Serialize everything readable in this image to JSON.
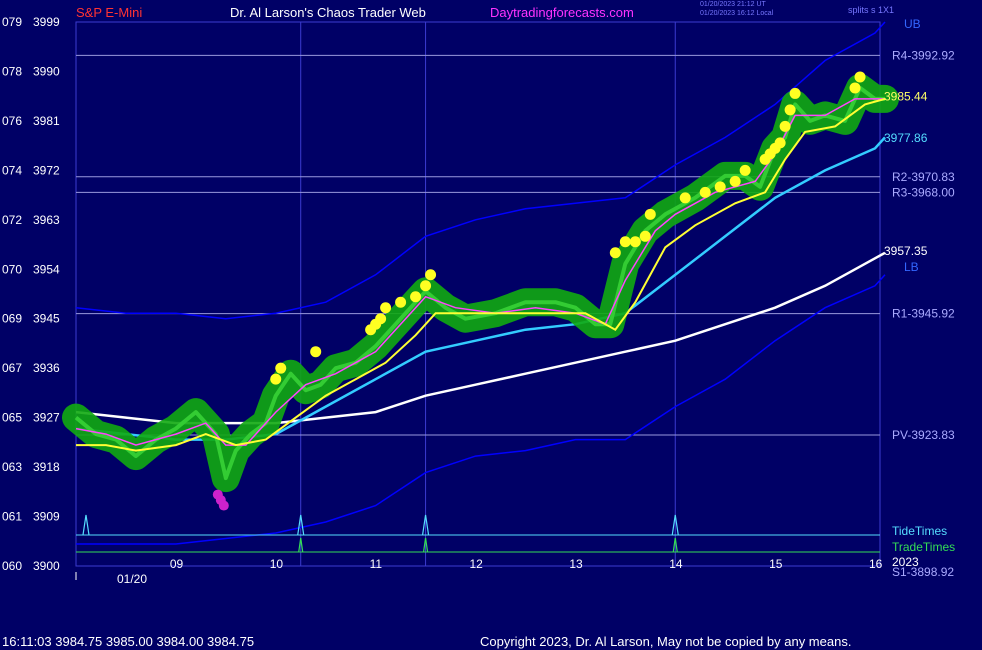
{
  "header": {
    "symbol": "S&P E-Mini",
    "title": "Dr. Al Larson's Chaos Trader Web",
    "site": "Daytradingforecasts.com",
    "timestamp_ut": "01/20/2023 21:12 UT",
    "timestamp_local": "01/20/2023 16:12 Local",
    "splits": "splits s 1X1"
  },
  "footer": {
    "last_bar": "16:11:03  3984.75 3985.00 3984.00 3984.75",
    "copyright": "Copyright 2023, Dr. Al Larson, May not be copied by any means."
  },
  "colors": {
    "background": "#000066",
    "grid": "#3b3bd0",
    "price": "#33cc33",
    "glow": "#11aa11",
    "ema_fast": "#ff44ff",
    "ema_slow": "#ffff33",
    "band": "#0000ff",
    "mid_line": "#33ccff",
    "pivot_line": "#ffffff",
    "markers_up": "#ffff22",
    "markers_down": "#cc22cc",
    "tide": "#55ddff",
    "trade": "#33dd55",
    "level_label": "#aaaaff"
  },
  "chart_data": {
    "type": "line",
    "title": "S&P E-Mini",
    "date": "01/20",
    "year": "2023",
    "ylim": [
      3900,
      3999
    ],
    "xlim": [
      8.0,
      16.05
    ],
    "y_ticks": [
      {
        "left": "079",
        "value": 3999
      },
      {
        "left": "078",
        "value": 3990
      },
      {
        "left": "076",
        "value": 3981
      },
      {
        "left": "074",
        "value": 3972
      },
      {
        "left": "072",
        "value": 3963
      },
      {
        "left": "070",
        "value": 3954
      },
      {
        "left": "069",
        "value": 3945
      },
      {
        "left": "067",
        "value": 3936
      },
      {
        "left": "065",
        "value": 3927
      },
      {
        "left": "063",
        "value": 3918
      },
      {
        "left": "061",
        "value": 3909
      },
      {
        "left": "060",
        "value": 3900
      }
    ],
    "x_ticks": [
      {
        "label": "09",
        "hour": 9
      },
      {
        "label": "10",
        "hour": 10
      },
      {
        "label": "11",
        "hour": 11
      },
      {
        "label": "12",
        "hour": 12
      },
      {
        "label": "13",
        "hour": 13
      },
      {
        "label": "14",
        "hour": 14
      },
      {
        "label": "15",
        "hour": 15
      },
      {
        "label": "16",
        "hour": 16
      }
    ],
    "levels": [
      {
        "label": "R4-3992.92",
        "value": 3992.92
      },
      {
        "label": "R2-3970.83",
        "value": 3970.83
      },
      {
        "label": "R3-3968.00",
        "value": 3968.0
      },
      {
        "label": "R1-3945.92",
        "value": 3945.92
      },
      {
        "label": "PV-3923.83",
        "value": 3923.83
      },
      {
        "label": "S1-3898.92",
        "value": 3898.92
      }
    ],
    "grid_vertical_hours": [
      10.25,
      11.5,
      14.0
    ],
    "band_labels": {
      "upper": "UB",
      "lower": "LB"
    },
    "value_labels": [
      {
        "text": "3985.44",
        "value": 3985.44,
        "color": "#ffff66"
      },
      {
        "text": "3977.86",
        "value": 3977.86,
        "color": "#55ddff"
      },
      {
        "text": "3957.35",
        "value": 3957.35,
        "color": "#ffffff"
      }
    ],
    "tide_times": {
      "label": "TideTimes",
      "hours": [
        8.1,
        10.25,
        11.5,
        14.0
      ]
    },
    "trade_times": {
      "label": "TradeTimes",
      "hours": [
        10.25,
        11.5,
        14.0
      ]
    },
    "series": [
      {
        "name": "price",
        "x": [
          8.0,
          8.2,
          8.4,
          8.6,
          8.8,
          9.0,
          9.2,
          9.4,
          9.5,
          9.6,
          9.75,
          9.9,
          10.0,
          10.15,
          10.3,
          10.45,
          10.6,
          10.8,
          11.0,
          11.2,
          11.4,
          11.5,
          11.7,
          11.9,
          12.2,
          12.5,
          12.8,
          13.0,
          13.2,
          13.35,
          13.5,
          13.7,
          13.9,
          14.0,
          14.2,
          14.5,
          14.7,
          14.85,
          15.0,
          15.1,
          15.2,
          15.35,
          15.5,
          15.7,
          15.85,
          16.0,
          16.1
        ],
        "y": [
          3927,
          3924,
          3923,
          3920,
          3923,
          3925,
          3928,
          3924,
          3916,
          3921,
          3924,
          3926,
          3931,
          3935,
          3932,
          3933,
          3936,
          3937,
          3940,
          3944,
          3948,
          3950,
          3947,
          3945,
          3946,
          3948,
          3948,
          3947,
          3944,
          3944,
          3955,
          3961,
          3964,
          3965,
          3967,
          3971,
          3971,
          3969,
          3976,
          3978,
          3984,
          3981,
          3982,
          3981,
          3987,
          3985,
          3985
        ]
      },
      {
        "name": "ema_fast",
        "x": [
          8.0,
          8.3,
          8.6,
          9.0,
          9.3,
          9.5,
          9.7,
          10.0,
          10.3,
          10.6,
          11.0,
          11.3,
          11.5,
          11.8,
          12.2,
          12.6,
          13.0,
          13.3,
          13.5,
          13.8,
          14.0,
          14.4,
          14.8,
          15.0,
          15.2,
          15.5,
          15.8,
          16.0,
          16.1
        ],
        "y": [
          3925,
          3924,
          3922,
          3924,
          3926,
          3922,
          3922,
          3928,
          3933,
          3935,
          3939,
          3945,
          3949,
          3947,
          3946,
          3947,
          3946,
          3944,
          3952,
          3961,
          3964,
          3968,
          3970,
          3975,
          3982,
          3982,
          3985,
          3985,
          3985
        ]
      },
      {
        "name": "ema_slow",
        "x": [
          8.0,
          8.3,
          8.6,
          9.0,
          9.3,
          9.6,
          9.9,
          10.2,
          10.5,
          10.8,
          11.1,
          11.4,
          11.6,
          12.0,
          12.4,
          12.8,
          13.1,
          13.4,
          13.6,
          13.9,
          14.2,
          14.6,
          14.9,
          15.1,
          15.3,
          15.6,
          15.9,
          16.1
        ],
        "y": [
          3922,
          3922,
          3921,
          3922,
          3924,
          3922,
          3923,
          3927,
          3931,
          3934,
          3937,
          3942,
          3946,
          3946,
          3946,
          3946,
          3946,
          3943,
          3948,
          3958,
          3962,
          3966,
          3968,
          3974,
          3979,
          3980,
          3984,
          3985
        ]
      },
      {
        "name": "upper_band",
        "x": [
          8.0,
          8.5,
          9.0,
          9.5,
          10.0,
          10.5,
          11.0,
          11.5,
          12.0,
          12.5,
          13.0,
          13.5,
          14.0,
          14.5,
          15.0,
          15.5,
          16.0,
          16.1
        ],
        "y": [
          3947,
          3946,
          3946,
          3945,
          3946,
          3948,
          3953,
          3960,
          3963,
          3965,
          3966,
          3967,
          3973,
          3978,
          3984,
          3992,
          3997,
          3999
        ]
      },
      {
        "name": "lower_band",
        "x": [
          8.0,
          8.5,
          9.0,
          9.5,
          10.0,
          10.5,
          11.0,
          11.5,
          12.0,
          12.5,
          13.0,
          13.5,
          14.0,
          14.5,
          15.0,
          15.5,
          16.0,
          16.1
        ],
        "y": [
          3904,
          3904,
          3904,
          3905,
          3906,
          3908,
          3911,
          3917,
          3920,
          3921,
          3923,
          3923,
          3929,
          3934,
          3941,
          3947,
          3951,
          3953
        ]
      },
      {
        "name": "mid_line",
        "x": [
          8.0,
          8.5,
          9.0,
          9.5,
          10.0,
          10.5,
          11.0,
          11.5,
          12.0,
          12.5,
          13.0,
          13.5,
          14.0,
          14.5,
          15.0,
          15.5,
          16.0,
          16.1
        ],
        "y": [
          3925,
          3924,
          3923,
          3923,
          3924,
          3929,
          3934,
          3939,
          3941,
          3943,
          3944,
          3946,
          3953,
          3960,
          3967,
          3972,
          3976,
          3978
        ]
      },
      {
        "name": "pivot_avg",
        "x": [
          8.0,
          8.5,
          9.0,
          9.5,
          10.0,
          10.5,
          11.0,
          11.5,
          12.0,
          12.5,
          13.0,
          13.5,
          14.0,
          14.5,
          15.0,
          15.5,
          16.0,
          16.1
        ],
        "y": [
          3928,
          3927,
          3926,
          3926,
          3926,
          3927,
          3928,
          3931,
          3933,
          3935,
          3937,
          3939,
          3941,
          3944,
          3947,
          3951,
          3956,
          3957
        ]
      }
    ],
    "markers_up": [
      {
        "x": 10.0,
        "y": 3934
      },
      {
        "x": 10.05,
        "y": 3936
      },
      {
        "x": 10.4,
        "y": 3939
      },
      {
        "x": 10.95,
        "y": 3943
      },
      {
        "x": 11.0,
        "y": 3944
      },
      {
        "x": 11.05,
        "y": 3945
      },
      {
        "x": 11.1,
        "y": 3947
      },
      {
        "x": 11.25,
        "y": 3948
      },
      {
        "x": 11.4,
        "y": 3949
      },
      {
        "x": 11.5,
        "y": 3951
      },
      {
        "x": 11.55,
        "y": 3953
      },
      {
        "x": 13.4,
        "y": 3957
      },
      {
        "x": 13.5,
        "y": 3959
      },
      {
        "x": 13.6,
        "y": 3959
      },
      {
        "x": 13.7,
        "y": 3960
      },
      {
        "x": 13.75,
        "y": 3964
      },
      {
        "x": 14.1,
        "y": 3967
      },
      {
        "x": 14.3,
        "y": 3968
      },
      {
        "x": 14.45,
        "y": 3969
      },
      {
        "x": 14.6,
        "y": 3970
      },
      {
        "x": 14.7,
        "y": 3972
      },
      {
        "x": 14.9,
        "y": 3974
      },
      {
        "x": 14.95,
        "y": 3975
      },
      {
        "x": 15.0,
        "y": 3976
      },
      {
        "x": 15.05,
        "y": 3977
      },
      {
        "x": 15.1,
        "y": 3980
      },
      {
        "x": 15.15,
        "y": 3983
      },
      {
        "x": 15.2,
        "y": 3986
      },
      {
        "x": 15.8,
        "y": 3987
      },
      {
        "x": 15.85,
        "y": 3989
      }
    ],
    "markers_down": [
      {
        "x": 9.42,
        "y": 3913
      },
      {
        "x": 9.45,
        "y": 3912
      },
      {
        "x": 9.48,
        "y": 3911
      }
    ]
  }
}
